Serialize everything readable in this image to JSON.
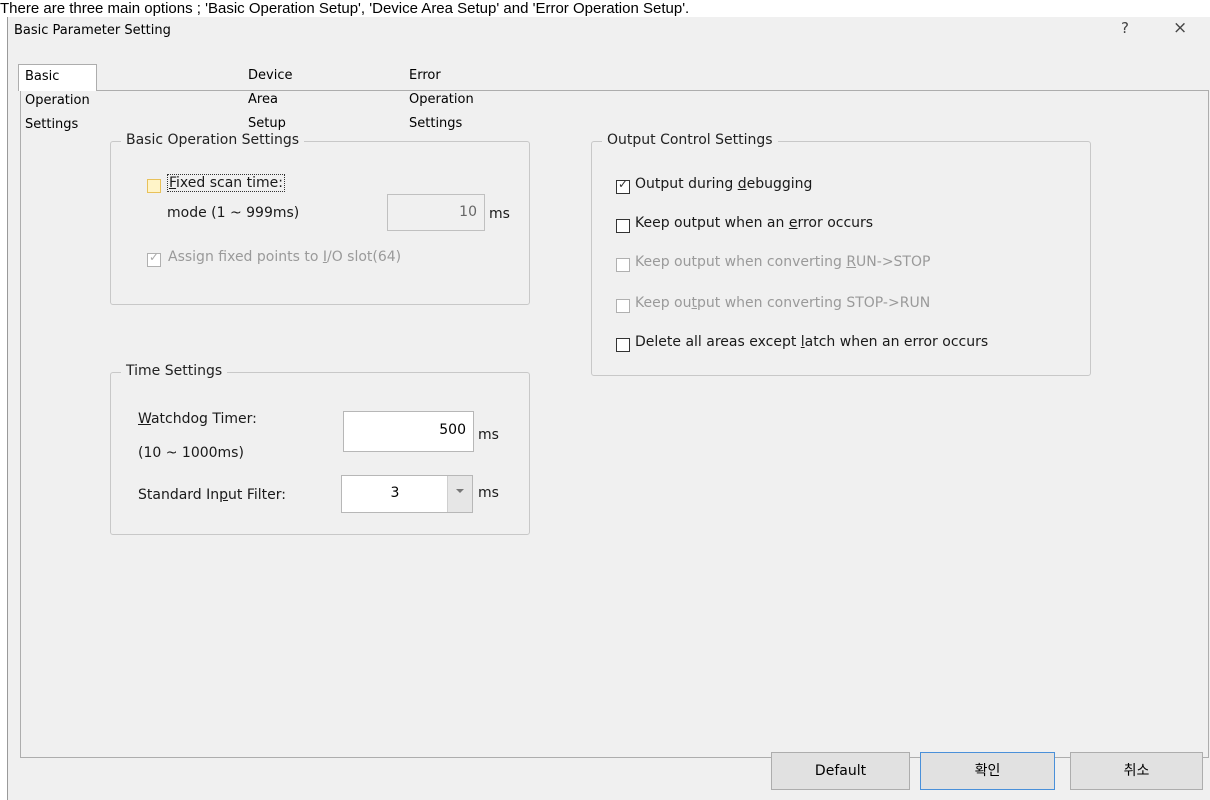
{
  "caption": "There are three main options ; 'Basic Operation Setup', 'Device Area Setup' and 'Error Operation Setup'.",
  "window": {
    "title": "Basic Parameter Setting",
    "help_label": "?",
    "close_label": "×"
  },
  "tabs": [
    "Basic Operation Settings",
    "Device Area Setup",
    "Error Operation Settings"
  ],
  "basic_group": {
    "legend": "Basic Operation Settings",
    "fixed_scan": {
      "label_pre": "",
      "label_mnemonic": "F",
      "label_post": "ixed scan time:",
      "checked": false,
      "mode_label": "mode (1 ~ 999ms)",
      "value": "10",
      "unit": "ms"
    },
    "assign_io": {
      "label_pre": "Assign fixed points to ",
      "label_mnemonic": "I",
      "label_post": "/O slot(64)",
      "checked": true,
      "enabled": false
    }
  },
  "time_group": {
    "legend": "Time Settings",
    "watchdog": {
      "label_pre": "",
      "label_mnemonic": "W",
      "label_post": "atchdog Timer:",
      "range": "(10 ~ 1000ms)",
      "value": "500",
      "unit": "ms"
    },
    "input_filter": {
      "label_pre": "Standard In",
      "label_mnemonic": "p",
      "label_post": "ut Filter:",
      "value": "3",
      "unit": "ms"
    }
  },
  "output_group": {
    "legend": "Output Control Settings",
    "items": [
      {
        "pre": "Output during ",
        "mnemonic": "d",
        "post": "ebugging",
        "checked": true,
        "enabled": true
      },
      {
        "pre": "Keep output when an ",
        "mnemonic": "e",
        "post": "rror occurs",
        "checked": false,
        "enabled": true
      },
      {
        "pre": "Keep output when converting ",
        "mnemonic": "R",
        "post": "UN->STOP",
        "checked": false,
        "enabled": false
      },
      {
        "pre": "Keep ou",
        "mnemonic": "t",
        "post": "put when converting STOP->RUN",
        "checked": false,
        "enabled": false
      },
      {
        "pre": "Delete all areas except ",
        "mnemonic": "l",
        "post": "atch when an error occurs",
        "checked": false,
        "enabled": true
      }
    ]
  },
  "buttons": {
    "default": "Default",
    "ok": "확인",
    "cancel": "취소"
  },
  "colors": {
    "dialog_bg": "#f0f0f0",
    "group_border": "#c8c8c8",
    "disabled_text": "#9a9a9a",
    "focus_highlight": "#fff4c8",
    "primary_border": "#4a90d9"
  }
}
